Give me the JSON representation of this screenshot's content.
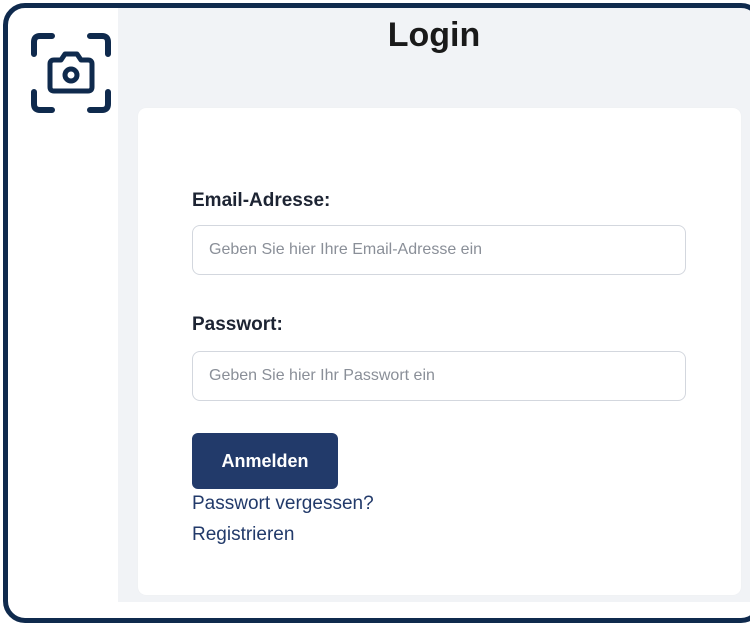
{
  "page": {
    "title": "Login"
  },
  "sidebar": {
    "logo_icon": "camera-scan-icon"
  },
  "form": {
    "email_label": "Email-Adresse:",
    "email_placeholder": "Geben Sie hier Ihre Email-Adresse ein",
    "email_value": "",
    "password_label": "Passwort:",
    "password_placeholder": "Geben Sie hier Ihr Passwort ein",
    "password_value": "",
    "submit_label": "Anmelden",
    "forgot_password_link": "Passwort vergessen?",
    "register_link": "Registrieren"
  },
  "colors": {
    "frame_border": "#0f2a4d",
    "primary": "#223a6a",
    "content_background": "#f1f3f6",
    "card_background": "#ffffff"
  }
}
